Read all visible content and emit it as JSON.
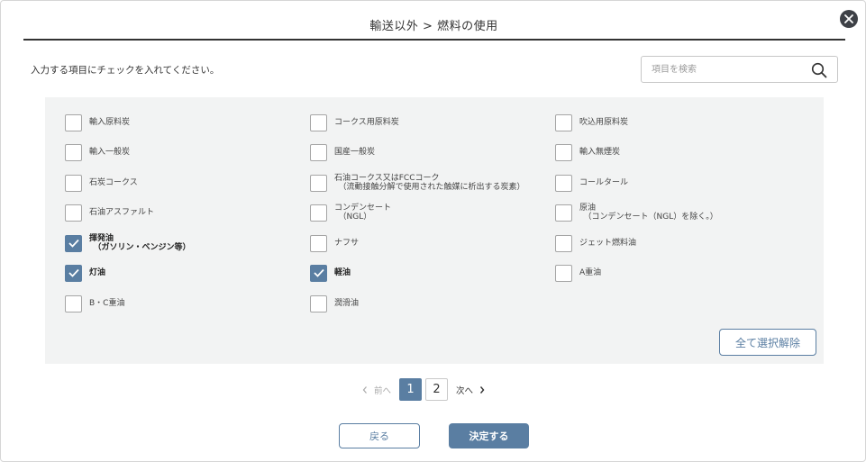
{
  "dialog": {
    "title": "輸送以外 > 燃料の使用",
    "instruction": "入力する項目にチェックを入れてください。",
    "search_placeholder": "項目を検索",
    "close_icon": "close-icon"
  },
  "fuels": [
    {
      "label": "輸入原料炭",
      "checked": false
    },
    {
      "label": "コークス用原料炭",
      "checked": false
    },
    {
      "label": "吹込用原料炭",
      "checked": false
    },
    {
      "label": "輸入一般炭",
      "checked": false
    },
    {
      "label": "国産一般炭",
      "checked": false
    },
    {
      "label": "輸入無煙炭",
      "checked": false
    },
    {
      "label": "石炭コークス",
      "checked": false
    },
    {
      "label": "石油コークス又はFCCコーク\n　（流動接触分解で使用された触媒に析出する炭素）",
      "checked": false
    },
    {
      "label": "コールタール",
      "checked": false
    },
    {
      "label": "石油アスファルト",
      "checked": false
    },
    {
      "label": "コンデンセート\n　（NGL）",
      "checked": false
    },
    {
      "label": "原油\n　（コンデンセート（NGL）を除く。）",
      "checked": false
    },
    {
      "label": "揮発油\n　（ガソリン・ベンジン等）",
      "checked": true
    },
    {
      "label": "ナフサ",
      "checked": false
    },
    {
      "label": "ジェット燃料油",
      "checked": false
    },
    {
      "label": "灯油",
      "checked": true
    },
    {
      "label": "軽油",
      "checked": true
    },
    {
      "label": "A重油",
      "checked": false
    },
    {
      "label": "B・C重油",
      "checked": false
    },
    {
      "label": "潤滑油",
      "checked": false
    }
  ],
  "clear_all_label": "全て選択解除",
  "pagination": {
    "prev_label": "前へ",
    "next_label": "次へ",
    "pages": [
      "1",
      "2"
    ],
    "current": "1"
  },
  "footer": {
    "back_label": "戻る",
    "confirm_label": "決定する"
  },
  "colors": {
    "accent": "#5a7ea2",
    "panel_bg": "#f2f3f3",
    "close_bg": "#3e4147"
  }
}
